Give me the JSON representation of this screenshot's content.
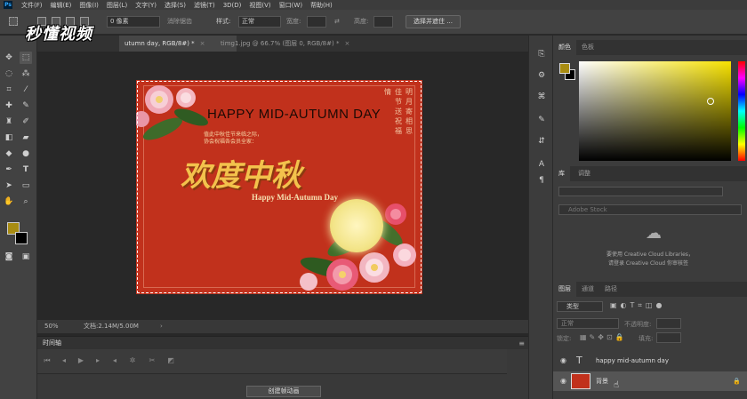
{
  "menubar": {
    "logo": "Ps",
    "items": [
      "文件(F)",
      "编辑(E)",
      "图像(I)",
      "图层(L)",
      "文字(Y)",
      "选择(S)",
      "滤镜(T)",
      "3D(D)",
      "视图(V)",
      "窗口(W)",
      "帮助(H)"
    ]
  },
  "options": {
    "feather_value": "0 像素",
    "antialias": "消除锯齿",
    "style_label": "样式:",
    "style_value": "正常",
    "width_label": "宽度:",
    "height_label": "高度:",
    "select_mask_btn": "选择并遮住 ..."
  },
  "watermark": "秒懂视频",
  "tabs": [
    {
      "label": "utumn day, RGB/8#) *",
      "close": "×"
    },
    {
      "label": "timg1.jpg @ 66.7% (图层 0, RGB/8#) *",
      "close": "×"
    }
  ],
  "document": {
    "title": "HAPPY MID-AUTUMN DAY",
    "line1": "值此中秋佳节来临之际，",
    "line2": "协会祝福各会员全家：",
    "big": "欢度中秋",
    "sub": "Happy Mid-Autumn Day",
    "vert_col1": "明月寄相思",
    "vert_col2": "佳节送祝福",
    "vert_col3": "情"
  },
  "status": {
    "zoom": "50%",
    "doc": "文档:2.14M/5.00M"
  },
  "timeline": {
    "label": "时间轴",
    "create_btn": "创建帧动画"
  },
  "color_panel": {
    "tabs": [
      "颜色",
      "色板"
    ],
    "foreground": "#a88c12",
    "background": "#000000"
  },
  "library_panel": {
    "tabs": [
      "库",
      "调整"
    ],
    "search_placeholder": "Adobe Stock",
    "msg1": "要使用 Creative Cloud Libraries，",
    "msg2": "请登录 Creative Cloud 你审核签"
  },
  "layers_panel": {
    "tabs": [
      "图层",
      "通道",
      "路径"
    ],
    "filter_label": "类型",
    "blend": "正常",
    "opacity_label": "不透明度:",
    "lock_label": "锁定:",
    "fill_label": "填充:",
    "layers": [
      {
        "name": "happy mid-autumn day",
        "kind": "T"
      },
      {
        "name": "背景",
        "kind": "image"
      }
    ]
  }
}
